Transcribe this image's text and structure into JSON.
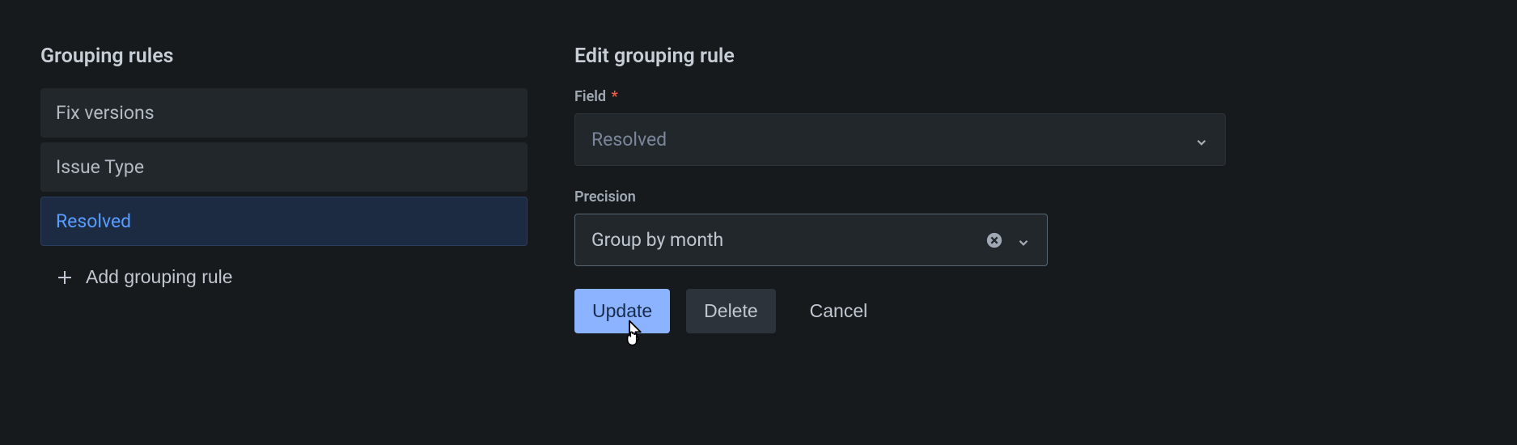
{
  "left": {
    "title": "Grouping rules",
    "rules": [
      {
        "label": "Fix versions",
        "selected": false
      },
      {
        "label": "Issue Type",
        "selected": false
      },
      {
        "label": "Resolved",
        "selected": true
      }
    ],
    "add_button": "Add grouping rule"
  },
  "right": {
    "title": "Edit grouping rule",
    "field_label": "Field",
    "field_required": "*",
    "field_value": "Resolved",
    "precision_label": "Precision",
    "precision_value": "Group by month",
    "update_button": "Update",
    "delete_button": "Delete",
    "cancel_button": "Cancel"
  }
}
